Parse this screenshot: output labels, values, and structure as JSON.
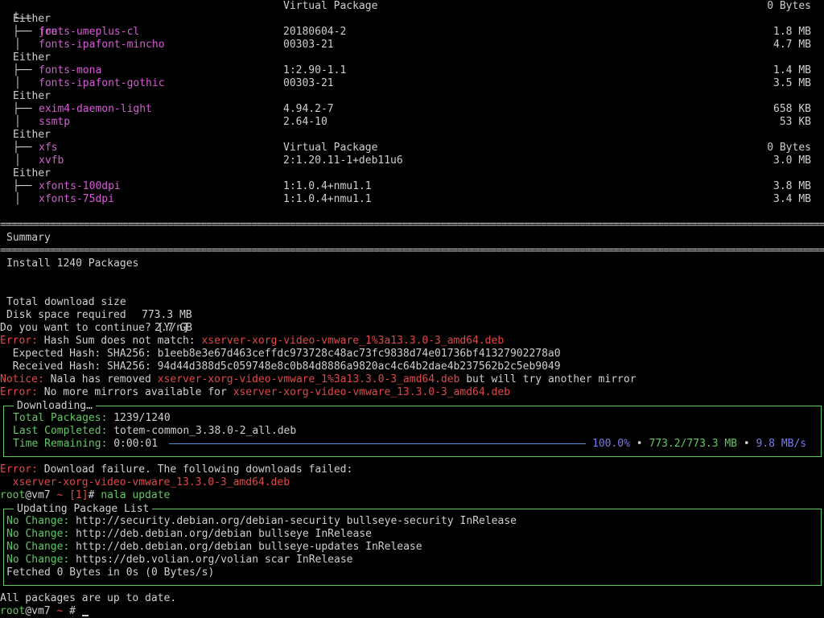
{
  "colors": {
    "package": "#d55cd5",
    "error": "#e04848",
    "green": "#62c862",
    "blue": "#7a7af0",
    "text": "#cfcfcf",
    "background": "#000000"
  },
  "packages_top": {
    "first": {
      "name": "jre",
      "version": "Virtual Package",
      "size": "0 Bytes"
    },
    "groups": [
      {
        "label": "Either",
        "items": [
          {
            "name": "fonts-umeplus-cl",
            "version": "20180604-2",
            "size": "1.8 MB"
          },
          {
            "name": "fonts-ipafont-mincho",
            "version": "00303-21",
            "size": "4.7 MB"
          }
        ]
      },
      {
        "label": "Either",
        "items": [
          {
            "name": "fonts-mona",
            "version": "1:2.90-1.1",
            "size": "1.4 MB"
          },
          {
            "name": "fonts-ipafont-gothic",
            "version": "00303-21",
            "size": "3.5 MB"
          }
        ]
      },
      {
        "label": "Either",
        "items": [
          {
            "name": "exim4-daemon-light",
            "version": "4.94.2-7",
            "size": "658 KB"
          },
          {
            "name": "ssmtp",
            "version": "2.64-10",
            "size": "53 KB"
          }
        ]
      },
      {
        "label": "Either",
        "items": [
          {
            "name": "xfs",
            "version": "Virtual Package",
            "size": "0 Bytes"
          },
          {
            "name": "xvfb",
            "version": "2:1.20.11-1+deb11u6",
            "size": "3.0 MB"
          }
        ]
      },
      {
        "label": "Either",
        "items": [
          {
            "name": "xfonts-100dpi",
            "version": "1:1.0.4+nmu1.1",
            "size": "3.8 MB"
          },
          {
            "name": "xfonts-75dpi",
            "version": "1:1.0.4+nmu1.1",
            "size": "3.4 MB"
          }
        ]
      }
    ]
  },
  "tree": {
    "branch": "├──",
    "last": "└──",
    "pipe": "│"
  },
  "separator": "==========================================================================================================================================================",
  "summary": {
    "title": "Summary",
    "install": "Install 1240 Packages",
    "download_label": "Total download size",
    "download_value": "773.3 MB",
    "disk_label": "Disk space required",
    "disk_value": "2.7 GB"
  },
  "prompt_continue": "Do you want to continue? [Y/n]",
  "errors": {
    "label": "Error:",
    "hash_text": " Hash Sum does not match: ",
    "hash_file": "xserver-xorg-video-vmware_1%3a13.3.0-3_amd64.deb",
    "expected": "  Expected Hash: SHA256: b1eeb8e3e67d463ceffdc973728c48ac73fc9838d74e01736bf41327902278a0",
    "received": "  Received Hash: SHA256: 94d44d388d5c059748e8c0b84d8886a9820ac4c64b2dae4b237562b2c5eb9049",
    "notice_label": "Notice:",
    "notice_text": " Nala has removed ",
    "notice_file": "xserver-xorg-video-vmware_1%3a13.3.0-3_amd64.deb",
    "notice_tail": " but will try another mirror",
    "mirrors_text": " No more mirrors available for ",
    "mirrors_file": "xserver-xorg-video-vmware_13.3.0-3_amd64.deb",
    "failure_text": " Download failure. The following downloads failed:",
    "failure_file": "  xserver-xorg-video-vmware_13.3.0-3_amd64.deb"
  },
  "downloading": {
    "title": "Downloading…",
    "total_label": "Total Packages:",
    "total_value": " 1239/1240",
    "last_label": "Last Completed:",
    "last_value": " totem-common_3.38.0-2_all.deb",
    "time_label": "Time Remaining:",
    "time_value": " 0:00:01",
    "progress_percent": "100.0%",
    "progress": 1.0,
    "bullet": "•",
    "transferred": "773.2/773.3 MB",
    "speed": "9.8 MB/s"
  },
  "prompt1": {
    "user": "root",
    "host": "@vm7",
    "tilde": " ~ ",
    "code": "[1]",
    "hash": "# ",
    "command": "nala update"
  },
  "updating": {
    "title": "Updating Package List",
    "label": "No Change:",
    "lines": [
      " http://security.debian.org/debian-security bullseye-security InRelease",
      " http://deb.debian.org/debian bullseye InRelease",
      " http://deb.debian.org/debian bullseye-updates InRelease",
      " https://deb.volian.org/volian scar InRelease"
    ],
    "fetched": "Fetched 0 Bytes in 0s (0 Bytes/s)"
  },
  "up_to_date": "All packages are up to date.",
  "prompt2": {
    "user": "root",
    "host": "@vm7",
    "tilde": " ~ ",
    "hash": "# "
  }
}
